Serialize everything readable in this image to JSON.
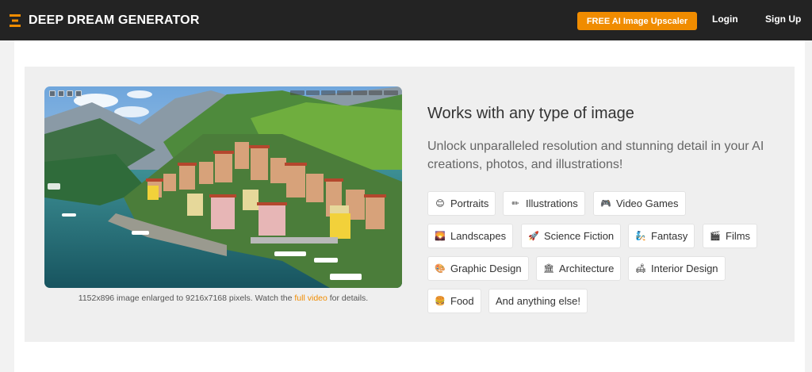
{
  "header": {
    "brand": "DEEP DREAM GENERATOR",
    "upscaler_label": "FREE AI Image Upscaler",
    "login_label": "Login",
    "signup_label": "Sign Up",
    "accent_color": "#f08c00"
  },
  "showcase": {
    "caption_prefix": "1152x896 image enlarged to 9216x7168 pixels. Watch the ",
    "caption_link": "full video",
    "caption_suffix": " for details."
  },
  "content": {
    "heading": "Works with any type of image",
    "subtext": "Unlock unparalleled resolution and stunning detail in your AI creations, photos, and illustrations!"
  },
  "tags": [
    {
      "label": "Portraits",
      "icon": "face-icon"
    },
    {
      "label": "Illustrations",
      "icon": "pencil-icon"
    },
    {
      "label": "Video Games",
      "icon": "gamepad-icon"
    },
    {
      "label": "Landscapes",
      "icon": "landscape-icon"
    },
    {
      "label": "Science Fiction",
      "icon": "rocket-icon"
    },
    {
      "label": "Fantasy",
      "icon": "genie-icon"
    },
    {
      "label": "Films",
      "icon": "clapperboard-icon"
    },
    {
      "label": "Graphic Design",
      "icon": "palette-icon"
    },
    {
      "label": "Architecture",
      "icon": "classical-building-icon"
    },
    {
      "label": "Interior Design",
      "icon": "couch-icon"
    },
    {
      "label": "Food",
      "icon": "burger-icon"
    },
    {
      "label": "And anything else!",
      "icon": ""
    }
  ]
}
